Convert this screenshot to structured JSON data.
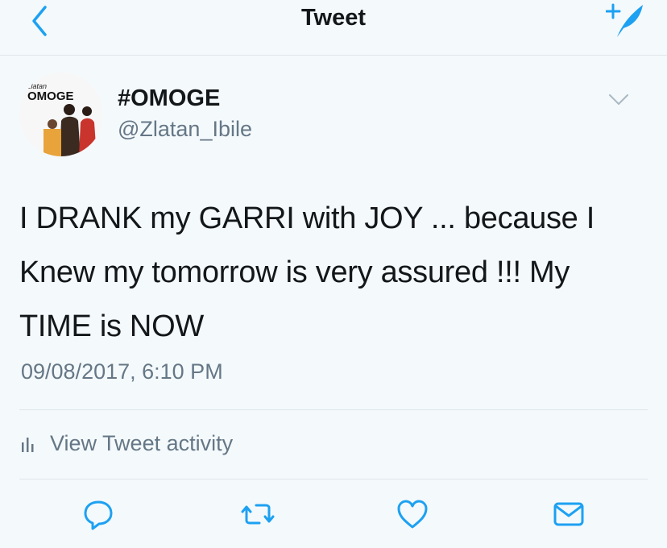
{
  "header": {
    "title": "Tweet",
    "back_icon": "chevron-left-icon",
    "compose_icon": "compose-tweet-icon"
  },
  "tweet": {
    "avatar": {
      "brand_text": "zlatan",
      "title_text": "OMOGE"
    },
    "display_name": "#OMOGE",
    "handle": "@Zlatan_Ibile",
    "text_lines": [
      "I DRANK my GARRI with  JOY ... because I",
      "Knew my tomorrow is very assured !!! My",
      "TIME is NOW"
    ],
    "timestamp": "09/08/2017, 6:10 PM",
    "activity_label": "View Tweet activity"
  },
  "actions": [
    "reply-icon",
    "retweet-icon",
    "like-icon",
    "share-icon"
  ],
  "colors": {
    "accent": "#1da1f2",
    "background": "#f4f9fc",
    "secondary_text": "#657786",
    "divider": "#dfe6ea"
  }
}
